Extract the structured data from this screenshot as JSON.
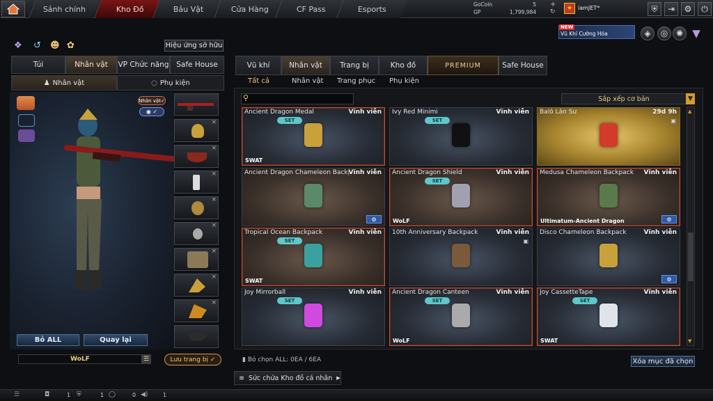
{
  "nav": {
    "tabs": [
      "Sảnh chính",
      "Kho Đồ",
      "Bảu Vật",
      "Cửa Hàng",
      "CF Pass",
      "Esports"
    ],
    "active_index": 1
  },
  "currency": {
    "gocoin_label": "GoCoin",
    "gocoin_value": "5",
    "gp_label": "GP",
    "gp_value": "1,799,984"
  },
  "user": {
    "name": "iamJET*"
  },
  "promo": {
    "badge": "NEW",
    "text": "Vũ Khí Cường Hóa"
  },
  "left": {
    "effects_button": "Hiệu ứng sở hữu",
    "tabs": [
      "Túi",
      "Nhân vật",
      "VP Chức năng",
      "Safe House"
    ],
    "active_tab": 1,
    "subtabs": [
      "Nhân vật",
      "Phụ kiện"
    ],
    "active_subtab": 0,
    "toggle_label": "Nhân vật",
    "remove_all": "Bỏ ALL",
    "back": "Quay lại",
    "clan_name": "WoLF",
    "save_button": "Lưu trang bị"
  },
  "right": {
    "tabs": [
      "Vũ khí",
      "Nhân vật",
      "Trang bị",
      "Kho đồ",
      "PREMIUM",
      "Safe House"
    ],
    "active_tab": 1,
    "filters": [
      "Tất cả",
      "Nhân vật",
      "Trang phục",
      "Phụ kiện"
    ],
    "active_filter": 0,
    "search_placeholder": "",
    "sort": "Sắp xếp cơ bản",
    "items": [
      {
        "name": "Ancient Dragon Medal",
        "duration": "Vĩnh viễn",
        "set": "SET",
        "tag": "SWAT",
        "style": "red"
      },
      {
        "name": "Ivy Red Minimi",
        "duration": "Vĩnh viễn",
        "set": "SET",
        "tag": "",
        "style": ""
      },
      {
        "name": "Balô Lân Sư",
        "duration": "29d 9h",
        "set": "",
        "tag": "",
        "style": "gold",
        "lock": true
      },
      {
        "name": "Ancient Dragon Chameleon Backpack",
        "duration": "Vĩnh viễn",
        "set": "",
        "tag": "",
        "style": "brown",
        "gear": true
      },
      {
        "name": "Ancient Dragon Shield",
        "duration": "Vĩnh viễn",
        "set": "SET",
        "tag": "WoLF",
        "style": "red brown"
      },
      {
        "name": "Medusa Chameleon Backpack",
        "duration": "Vĩnh viễn",
        "set": "",
        "tag": "Ultimatum-Ancient Dragon",
        "style": "red brown",
        "gear": true
      },
      {
        "name": "Tropical Ocean Backpack",
        "duration": "Vĩnh viễn",
        "set": "SET",
        "tag": "SWAT",
        "style": "red brown"
      },
      {
        "name": "10th Anniversary Backpack",
        "duration": "Vĩnh viễn",
        "set": "",
        "tag": "",
        "style": "",
        "lock": true
      },
      {
        "name": "Disco Chameleon Backpack",
        "duration": "Vĩnh viễn",
        "set": "",
        "tag": "",
        "style": "",
        "gear": true
      },
      {
        "name": "Joy Mirrorball",
        "duration": "Vĩnh viễn",
        "set": "SET",
        "tag": "",
        "style": ""
      },
      {
        "name": "Ancient Dragon Canteen",
        "duration": "Vĩnh viễn",
        "set": "SET",
        "tag": "WoLF",
        "style": "red"
      },
      {
        "name": "Joy CassetteTape",
        "duration": "Vĩnh viễn",
        "set": "SET",
        "tag": "SWAT",
        "style": "red"
      }
    ],
    "deselect_all": "Bỏ chọn ALL: 0EA / 6EA",
    "clear_selected": "Xóa mục đã chọn",
    "capacity": "Sức chứa Kho đồ cá nhân"
  },
  "bottom": {
    "v1": "1",
    "v2": "1",
    "v3": "0",
    "v4": "1"
  },
  "colors": {
    "accent_red": "#7a1414",
    "set_badge": "#5fc7c9",
    "gold": "#f0c77b"
  }
}
